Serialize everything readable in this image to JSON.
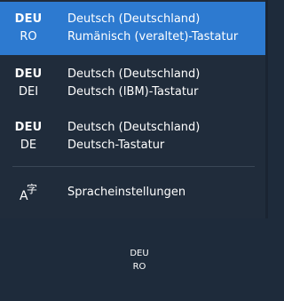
{
  "input_list": [
    {
      "lang": "DEU",
      "layout": "RO",
      "language": "Deutsch (Deutschland)",
      "keyboard": "Rumänisch (veraltet)-Tastatur",
      "selected": true
    },
    {
      "lang": "DEU",
      "layout": "DEI",
      "language": "Deutsch (Deutschland)",
      "keyboard": "Deutsch (IBM)-Tastatur",
      "selected": false
    },
    {
      "lang": "DEU",
      "layout": "DE",
      "language": "Deutsch (Deutschland)",
      "keyboard": "Deutsch-Tastatur",
      "selected": false
    }
  ],
  "settings": {
    "label": "Spracheinstellungen",
    "icon": "language-settings-icon"
  },
  "taskbar": {
    "lang": "DEU",
    "layout": "RO"
  },
  "colors": {
    "accent": "#2d7ad0",
    "background": "#202c3b"
  }
}
